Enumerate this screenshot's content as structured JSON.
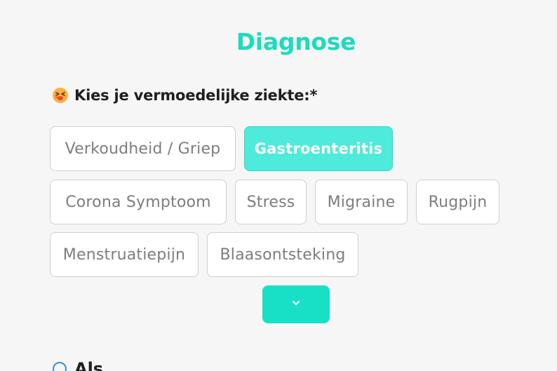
{
  "section": {
    "title": "Diagnose"
  },
  "question": {
    "label": "Kies je vermoedelijke ziekte:*",
    "emoji": "sick-face-emoji"
  },
  "options": [
    {
      "label": "Verkoudheid / Griep",
      "selected": false
    },
    {
      "label": "Gastroenteritis",
      "selected": true
    },
    {
      "label": "Corona Symptoom",
      "selected": false
    },
    {
      "label": "Stress",
      "selected": false
    },
    {
      "label": "Migraine",
      "selected": false
    },
    {
      "label": "Rugpijn",
      "selected": false
    },
    {
      "label": "Menstruatiepijn",
      "selected": false
    },
    {
      "label": "Blaasontsteking",
      "selected": false
    }
  ],
  "expand_button": {
    "icon": "chevron-down-icon"
  },
  "next_question": {
    "label": "Als",
    "icon": "info-icon"
  },
  "colors": {
    "accent": "#1ddbbf",
    "selected_chip": "#4eeadb",
    "expand_button": "#18e0c6",
    "chip_border": "#cfcfcf",
    "chip_text": "#7d7d7d"
  }
}
